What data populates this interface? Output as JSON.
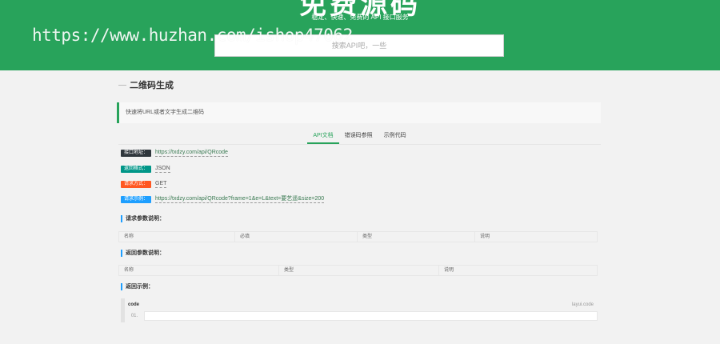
{
  "header": {
    "title": "免费源码",
    "subtitle": "稳定、快速、免费的 API 接口服务",
    "watermark": "https://www.huzhan.com/ishop47062",
    "search_placeholder": "搜索API吧，一些"
  },
  "page": {
    "title": "二维码生成",
    "description": "快速将URL或者文字生成二维码"
  },
  "tabs": [
    {
      "label": "API文档",
      "active": true
    },
    {
      "label": "错误码参照",
      "active": false
    },
    {
      "label": "示例代码",
      "active": false
    }
  ],
  "info": {
    "url": {
      "label": "接口地址：",
      "value": "https://txdzy.com/api/QRcode",
      "color": "#2f363c"
    },
    "format": {
      "label": "返回格式：",
      "value": "JSON",
      "color": "#009688"
    },
    "method": {
      "label": "请求方式：",
      "value": "GET",
      "color": "#ff5722"
    },
    "example": {
      "label": "请求示例：",
      "value": "https://txdzy.com/api/QRcode?frame=1&e=L&text=要艺遥&size=200",
      "color": "#1e9fff"
    }
  },
  "request_params": {
    "title": "请求参数说明：",
    "headers": [
      "名称",
      "必填",
      "类型",
      "说明"
    ]
  },
  "return_params": {
    "title": "返回参数说明：",
    "headers": [
      "名称",
      "类型",
      "说明"
    ]
  },
  "return_example": {
    "title": "返回示例：",
    "code_title": "code",
    "brand": "layui.code",
    "line_number": "01."
  },
  "colors": {
    "brand_green": "#28a35b",
    "accent_blue": "#1e9fff"
  }
}
